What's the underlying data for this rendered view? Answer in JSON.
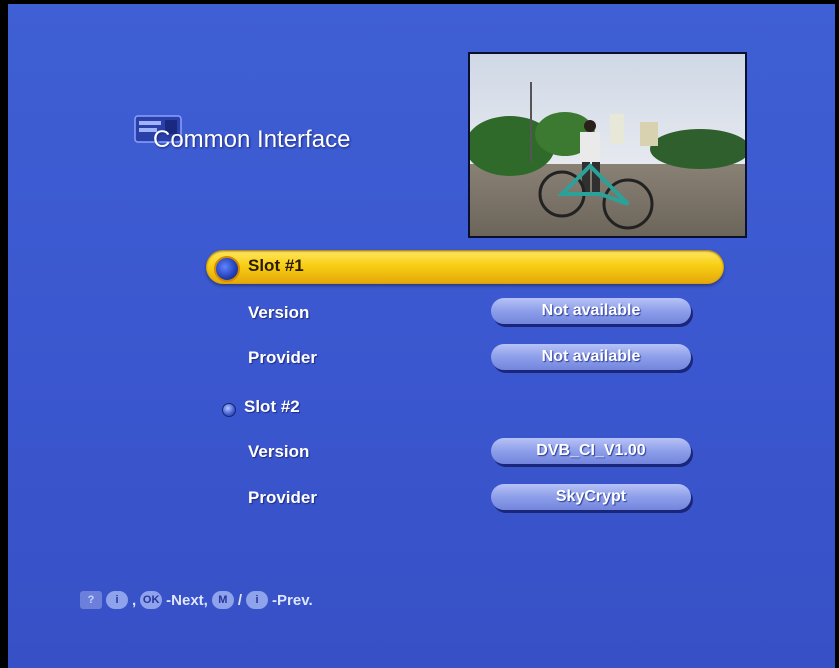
{
  "header": {
    "title": "Common Interface",
    "icon": "ci-module-icon"
  },
  "slot1": {
    "label": "Slot #1",
    "version_label": "Version",
    "version_value": "Not available",
    "provider_label": "Provider",
    "provider_value": "Not available"
  },
  "slot2": {
    "label": "Slot #2",
    "version_label": "Version",
    "version_value": "DVB_CI_V1.00",
    "provider_label": "Provider",
    "provider_value": "SkyCrypt"
  },
  "help": {
    "q_key": "?",
    "info_key": "i",
    "sep1": ",",
    "ok_key": "OK",
    "next_text": "-Next,",
    "m_key": "M",
    "slash": "/",
    "back_key": "i",
    "prev_text": "-Prev."
  },
  "colors": {
    "background": "#3f5fd4",
    "highlight": "#f8cf14",
    "pill": "#8d9eea"
  }
}
